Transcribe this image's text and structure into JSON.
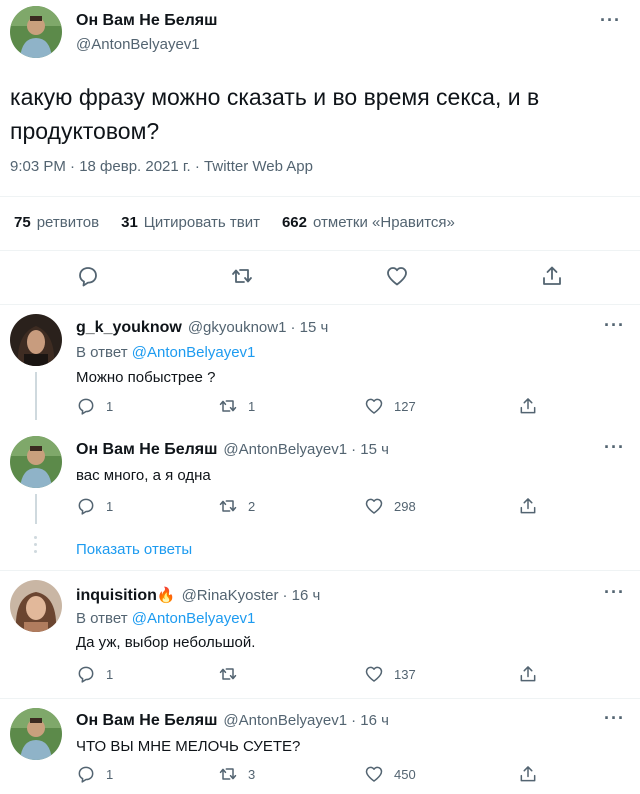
{
  "main_tweet": {
    "author_name": "Он Вам Не Беляш",
    "author_handle": "@AntonBelyayev1",
    "text_line1": "какую фразу можно сказать и во время секса, и в",
    "text_line2": "продуктовом?",
    "meta": "9:03 PM · 18 февр. 2021 г. · Twitter Web App",
    "retweets_count": "75",
    "retweets_label": "ретвитов",
    "quotes_count": "31",
    "quotes_label": "Цитировать твит",
    "likes_count": "662",
    "likes_label": "отметки «Нравится»",
    "more": "···"
  },
  "replies": [
    {
      "author_name": "g_k_youknow",
      "author_handle": "@gkyouknow1",
      "time": "· 15 ч",
      "reply_to_prefix": "В ответ",
      "reply_to_handle": "@AntonBelyayev1",
      "text": "Можно побыстрее ?",
      "reply_count": "1",
      "retweet_count": "1",
      "like_count": "127",
      "more": "···"
    },
    {
      "author_name": "Он Вам Не Беляш",
      "author_handle": "@AntonBelyayev1",
      "time": "· 15 ч",
      "text": "вас много, а я одна",
      "reply_count": "1",
      "retweet_count": "2",
      "like_count": "298",
      "more": "···"
    },
    {
      "author_name": "inquisition",
      "name_emoji": "🔥",
      "author_handle": "@RinaKyoster",
      "time": "· 16 ч",
      "reply_to_prefix": "В ответ",
      "reply_to_handle": "@AntonBelyayev1",
      "text": "Да уж, выбор небольшой.",
      "reply_count": "1",
      "retweet_count": "",
      "like_count": "137",
      "more": "···"
    },
    {
      "author_name": "Он Вам Не Беляш",
      "author_handle": "@AntonBelyayev1",
      "time": "· 16 ч",
      "text": "ЧТО ВЫ МНЕ МЕЛОЧЬ СУЕТЕ?",
      "reply_count": "1",
      "retweet_count": "3",
      "like_count": "450",
      "more": "···"
    }
  ],
  "show_replies_label": "Показать ответы",
  "colors": {
    "accent": "#1d9bf0",
    "secondary_text": "#536471",
    "divider": "#eff3f4",
    "thread_line": "#cfd9de"
  },
  "icons": [
    "reply-icon",
    "retweet-icon",
    "like-icon",
    "share-icon",
    "more-icon"
  ]
}
